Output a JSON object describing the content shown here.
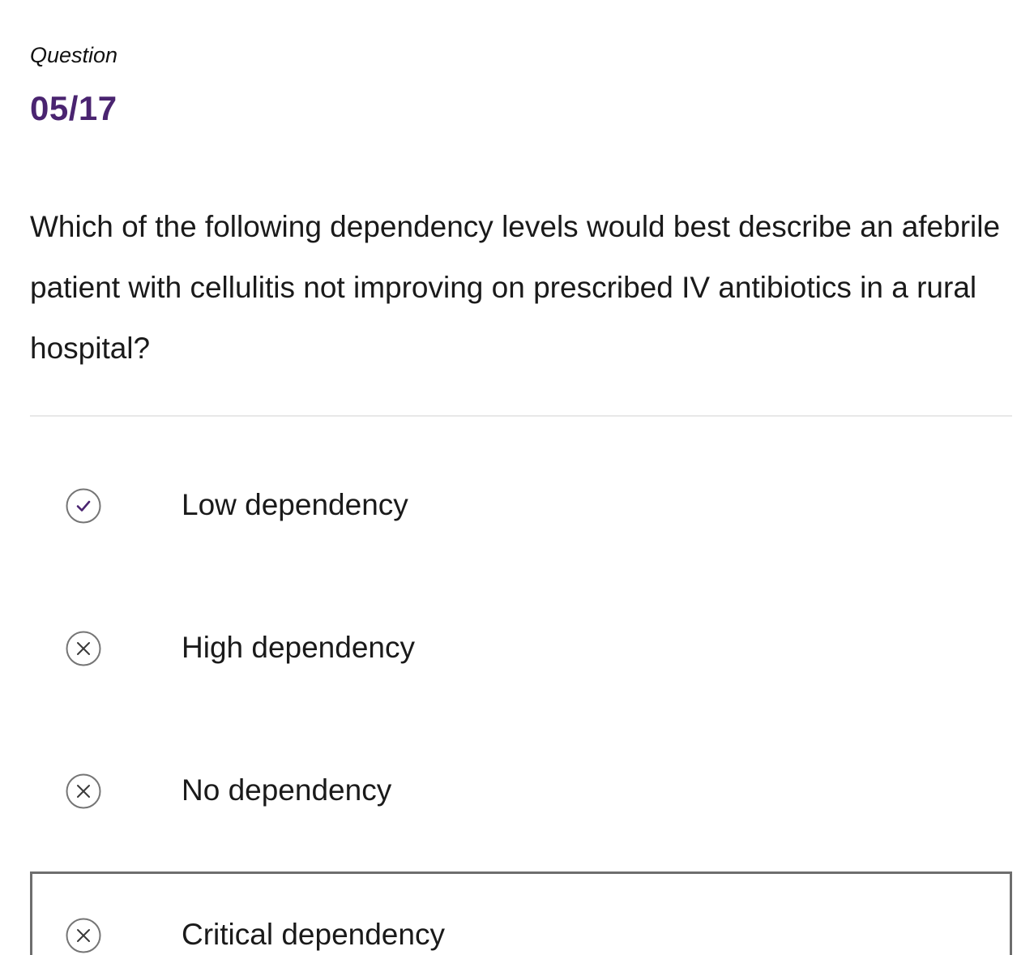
{
  "quiz": {
    "header_label": "Question",
    "counter": "05/17",
    "question": "Which of the following dependency levels would best describe an afebrile patient with cellulitis not improving on prescribed IV antibiotics in a rural hospital?"
  },
  "options": [
    {
      "label": "Low dependency",
      "status": "correct",
      "icon": "check-circle-icon"
    },
    {
      "label": "High dependency",
      "status": "incorrect",
      "icon": "x-circle-icon"
    },
    {
      "label": "No dependency",
      "status": "incorrect",
      "icon": "x-circle-icon"
    },
    {
      "label": "Critical dependency",
      "status": "incorrect",
      "icon": "x-circle-icon",
      "selected": true
    }
  ],
  "colors": {
    "accent": "#4a2470",
    "icon_outline": "#757575",
    "divider": "#e8e8e8",
    "selected_border": "#6e6e6e"
  }
}
